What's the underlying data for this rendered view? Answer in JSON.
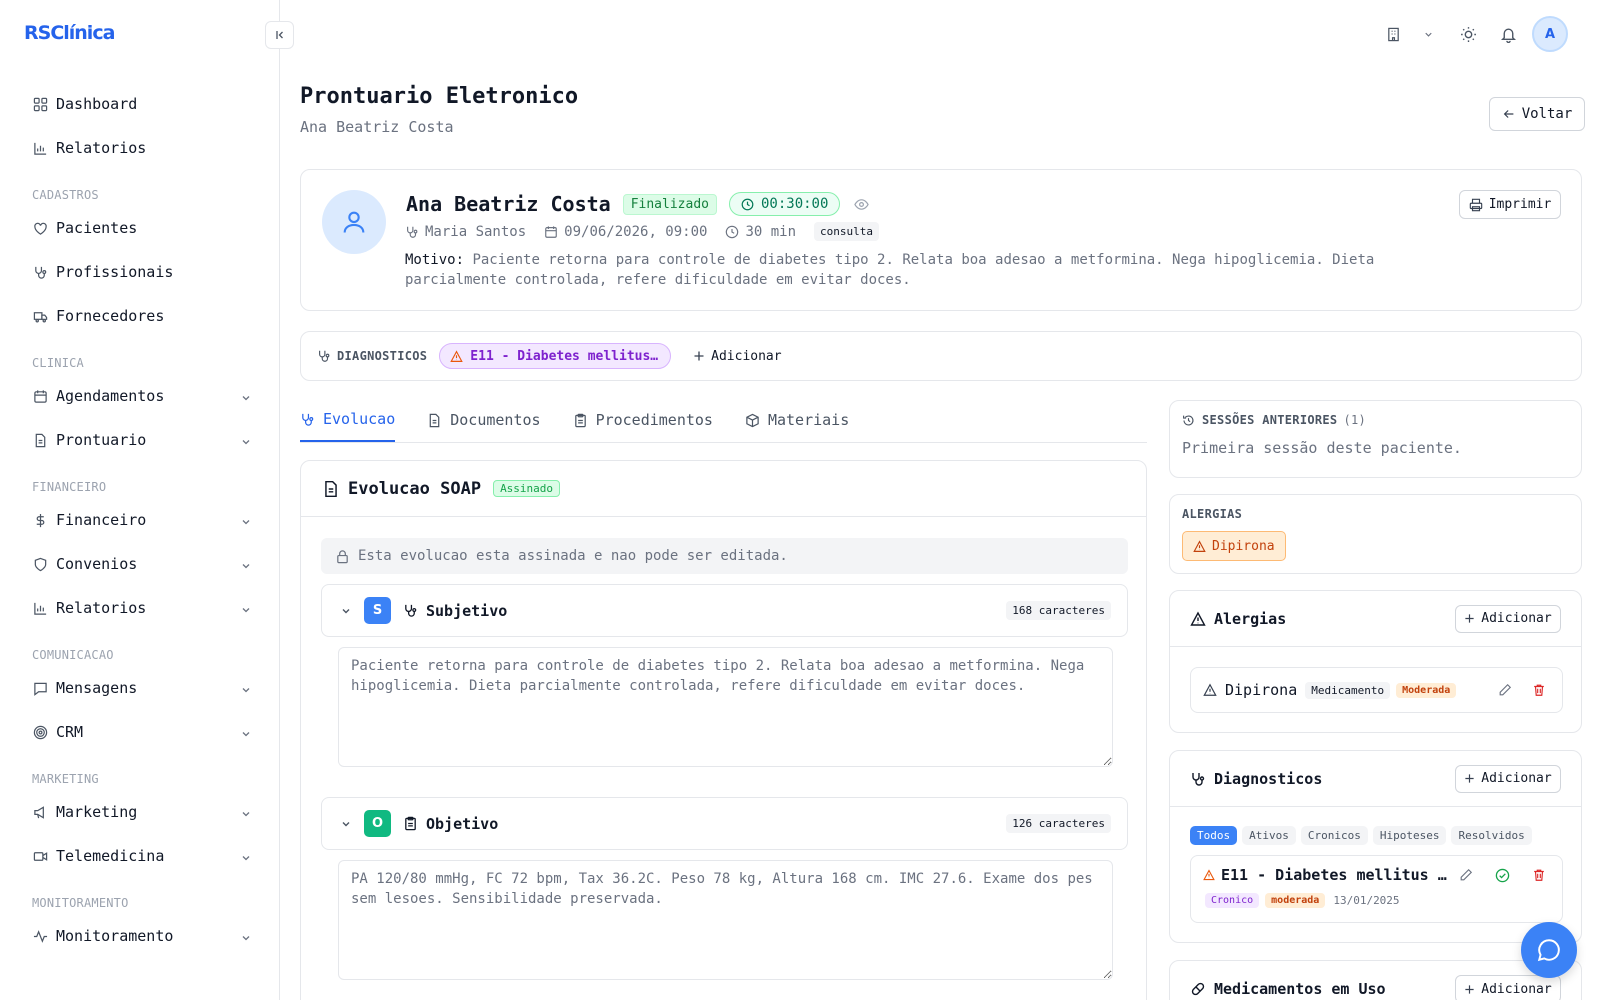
{
  "app": {
    "brand": "RSClínica"
  },
  "sidebar": {
    "items": [
      {
        "label": "Dashboard",
        "icon": "dashboard-icon"
      },
      {
        "label": "Relatorios",
        "icon": "bar-chart-icon"
      }
    ],
    "sections": [
      {
        "title": "CADASTROS",
        "items": [
          {
            "label": "Pacientes",
            "icon": "heart-icon"
          },
          {
            "label": "Profissionais",
            "icon": "stethoscope-icon"
          },
          {
            "label": "Fornecedores",
            "icon": "truck-icon"
          }
        ]
      },
      {
        "title": "CLINICA",
        "items": [
          {
            "label": "Agendamentos",
            "icon": "calendar-icon"
          },
          {
            "label": "Prontuario",
            "icon": "file-icon"
          }
        ]
      },
      {
        "title": "FINANCEIRO",
        "items": [
          {
            "label": "Financeiro",
            "icon": "dollar-icon"
          },
          {
            "label": "Convenios",
            "icon": "shield-icon"
          },
          {
            "label": "Relatorios",
            "icon": "bar-chart-icon"
          }
        ]
      },
      {
        "title": "COMUNICACAO",
        "items": [
          {
            "label": "Mensagens",
            "icon": "message-icon"
          },
          {
            "label": "CRM",
            "icon": "target-icon"
          }
        ]
      },
      {
        "title": "MARKETING",
        "items": [
          {
            "label": "Marketing",
            "icon": "megaphone-icon"
          },
          {
            "label": "Telemedicina",
            "icon": "video-icon"
          }
        ]
      },
      {
        "title": "MONITORAMENTO",
        "items": [
          {
            "label": "Monitoramento",
            "icon": "activity-icon"
          }
        ]
      }
    ]
  },
  "header": {
    "avatar_initial": "A"
  },
  "page": {
    "title": "Prontuario Eletronico",
    "subtitle": "Ana Beatriz Costa",
    "back_label": "Voltar"
  },
  "patient": {
    "name": "Ana Beatriz Costa",
    "status": "Finalizado",
    "timer": "00:30:00",
    "professional": "Maria Santos",
    "datetime": "09/06/2026, 09:00",
    "duration": "30 min",
    "type": "consulta",
    "motivo_label": "Motivo:",
    "motivo": "Paciente retorna para controle de diabetes tipo 2. Relata boa adesao a metformina. Nega hipoglicemia. Dieta parcialmente controlada, refere dificuldade em evitar doces.",
    "print_label": "Imprimir"
  },
  "diagnosis_bar": {
    "label": "DIAGNOSTICOS",
    "chip": "E11 - Diabetes mellitus…",
    "add_label": "Adicionar"
  },
  "tabs": [
    {
      "label": "Evolucao",
      "active": true
    },
    {
      "label": "Documentos"
    },
    {
      "label": "Procedimentos"
    },
    {
      "label": "Materiais"
    }
  ],
  "soap": {
    "title": "Evolucao SOAP",
    "status": "Assinado",
    "lock_message": "Esta evolucao esta assinada e nao pode ser editada.",
    "sections": [
      {
        "letter": "S",
        "label": "Subjetivo",
        "count": "168 caracteres",
        "color": "#3b82f6",
        "text": "Paciente retorna para controle de diabetes tipo 2. Relata boa adesao a metformina. Nega hipoglicemia. Dieta parcialmente controlada, refere dificuldade em evitar doces."
      },
      {
        "letter": "O",
        "label": "Objetivo",
        "count": "126 caracteres",
        "color": "#10b981",
        "text": "PA 120/80 mmHg, FC 72 bpm, Tax 36.2C. Peso 78 kg, Altura 168 cm. IMC 27.6. Exame dos pes sem lesoes. Sensibilidade preservada."
      }
    ]
  },
  "right": {
    "previous": {
      "title": "SESSÕES ANTERIORES",
      "count": "(1)",
      "text": "Primeira sessão deste paciente."
    },
    "allergies_summary": {
      "title": "ALERGIAS",
      "chip": "Dipirona"
    },
    "allergies": {
      "title": "Alergias",
      "add_label": "Adicionar",
      "items": [
        {
          "name": "Dipirona",
          "type": "Medicamento",
          "severity": "Moderada"
        }
      ]
    },
    "diagnoses": {
      "title": "Diagnosticos",
      "add_label": "Adicionar",
      "filters": [
        "Todos",
        "Ativos",
        "Cronicos",
        "Hipoteses",
        "Resolvidos"
      ],
      "items": [
        {
          "name": "E11 - Diabetes mellitus …",
          "tag1": "Cronico",
          "tag2": "moderada",
          "date": "13/01/2025"
        }
      ]
    },
    "medications": {
      "title": "Medicamentos em Uso",
      "add_label": "Adicionar"
    }
  }
}
